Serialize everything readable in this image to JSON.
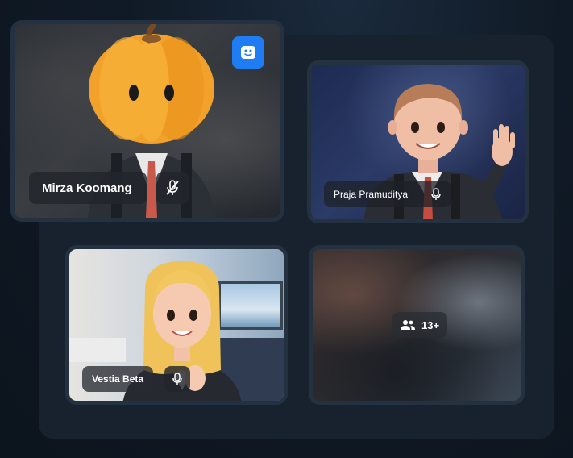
{
  "participants": [
    {
      "name": "Mirza Koomang",
      "mic": "muted",
      "avatar": "pumpkin-head-avatar"
    },
    {
      "name": "Praja Pramuditya",
      "mic": "on",
      "avatar": "waving-man-avatar"
    },
    {
      "name": "Vestia Beta",
      "mic": "on",
      "avatar": "blonde-woman-avatar"
    }
  ],
  "overflow": {
    "count_label": "13+",
    "icon": "people-icon"
  },
  "badge": {
    "icon": "app-logo-icon",
    "color": "#1f7cf2"
  },
  "colors": {
    "background": "#0f1822",
    "panel": "#17222e",
    "tile_border": "#243140"
  }
}
